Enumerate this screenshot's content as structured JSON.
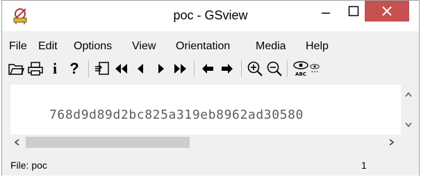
{
  "window": {
    "title": "poc - GSview"
  },
  "menu": {
    "items": [
      "File",
      "Edit",
      "Options",
      "View",
      "Orientation",
      "Media",
      "Help"
    ]
  },
  "toolbar": {
    "info_label": "i",
    "help_label": "?"
  },
  "document": {
    "text": "768d9d89d2bc825a319eb8962ad30580"
  },
  "status": {
    "file": "File: poc",
    "page": "1"
  },
  "colors": {
    "close_button": "#c75050",
    "document_background": "#ffffff",
    "chrome": "#f0f0f0"
  }
}
